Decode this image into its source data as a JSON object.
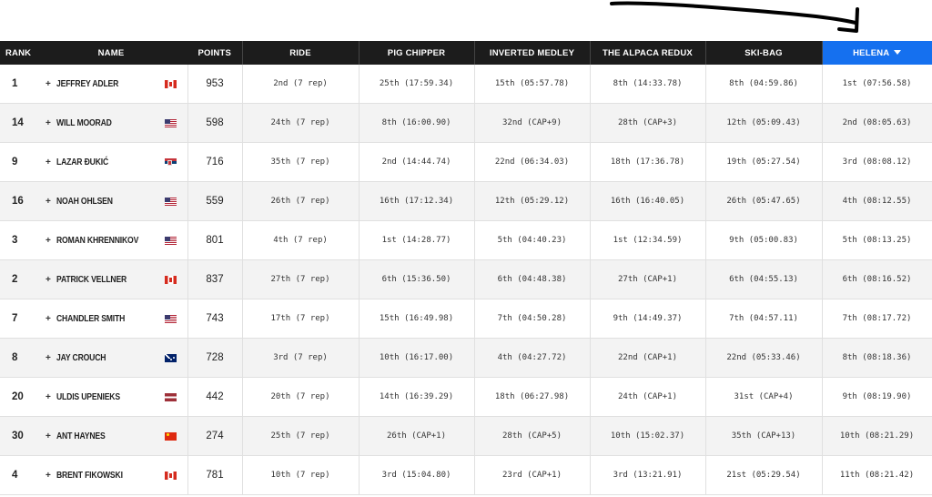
{
  "headers": {
    "rank": "RANK",
    "name": "NAME",
    "points": "POINTS",
    "events": [
      "RIDE",
      "PIG CHIPPER",
      "INVERTED MEDLEY",
      "THE ALPACA REDUX",
      "SKI-BAG",
      "HELENA"
    ],
    "sorted_event": "HELENA",
    "sort_icon": "caret-down-icon"
  },
  "colors": {
    "header_bg": "#1c1c1c",
    "active_header_bg": "#1570ef",
    "row_alt_bg": "#f3f3f3"
  },
  "rows": [
    {
      "rank": "1",
      "expand": "+",
      "name": "JEFFREY ADLER",
      "flag": "canada-flag-icon",
      "flag_class": "f-ca",
      "points": "953",
      "ride": "2nd (7 rep)",
      "pig_chipper": "25th (17:59.34)",
      "inverted_medley": "15th (05:57.78)",
      "alpaca_redux": "8th (14:33.78)",
      "ski_bag": "8th (04:59.86)",
      "helena": "1st (07:56.58)"
    },
    {
      "rank": "14",
      "expand": "+",
      "name": "WILL MOORAD",
      "flag": "usa-flag-icon",
      "flag_class": "f-us",
      "points": "598",
      "ride": "24th (7 rep)",
      "pig_chipper": "8th (16:00.90)",
      "inverted_medley": "32nd (CAP+9)",
      "alpaca_redux": "28th (CAP+3)",
      "ski_bag": "12th (05:09.43)",
      "helena": "2nd (08:05.63)"
    },
    {
      "rank": "9",
      "expand": "+",
      "name": "LAZAR ĐUKIĆ",
      "flag": "serbia-flag-icon",
      "flag_class": "f-rs",
      "points": "716",
      "ride": "35th (7 rep)",
      "pig_chipper": "2nd (14:44.74)",
      "inverted_medley": "22nd (06:34.03)",
      "alpaca_redux": "18th (17:36.78)",
      "ski_bag": "19th (05:27.54)",
      "helena": "3rd (08:08.12)"
    },
    {
      "rank": "16",
      "expand": "+",
      "name": "NOAH OHLSEN",
      "flag": "usa-flag-icon",
      "flag_class": "f-us",
      "points": "559",
      "ride": "26th (7 rep)",
      "pig_chipper": "16th (17:12.34)",
      "inverted_medley": "12th (05:29.12)",
      "alpaca_redux": "16th (16:40.05)",
      "ski_bag": "26th (05:47.65)",
      "helena": "4th (08:12.55)"
    },
    {
      "rank": "3",
      "expand": "+",
      "name": "ROMAN KHRENNIKOV",
      "flag": "usa-flag-icon",
      "flag_class": "f-us",
      "points": "801",
      "ride": "4th (7 rep)",
      "pig_chipper": "1st (14:28.77)",
      "inverted_medley": "5th (04:40.23)",
      "alpaca_redux": "1st (12:34.59)",
      "ski_bag": "9th (05:00.83)",
      "helena": "5th (08:13.25)"
    },
    {
      "rank": "2",
      "expand": "+",
      "name": "PATRICK VELLNER",
      "flag": "canada-flag-icon",
      "flag_class": "f-ca",
      "points": "837",
      "ride": "27th (7 rep)",
      "pig_chipper": "6th (15:36.50)",
      "inverted_medley": "6th (04:48.38)",
      "alpaca_redux": "27th (CAP+1)",
      "ski_bag": "6th (04:55.13)",
      "helena": "6th (08:16.52)"
    },
    {
      "rank": "7",
      "expand": "+",
      "name": "CHANDLER SMITH",
      "flag": "usa-flag-icon",
      "flag_class": "f-us",
      "points": "743",
      "ride": "17th (7 rep)",
      "pig_chipper": "15th (16:49.98)",
      "inverted_medley": "7th (04:50.28)",
      "alpaca_redux": "9th (14:49.37)",
      "ski_bag": "7th (04:57.11)",
      "helena": "7th (08:17.72)"
    },
    {
      "rank": "8",
      "expand": "+",
      "name": "JAY CROUCH",
      "flag": "australia-flag-icon",
      "flag_class": "f-au",
      "points": "728",
      "ride": "3rd (7 rep)",
      "pig_chipper": "10th (16:17.00)",
      "inverted_medley": "4th (04:27.72)",
      "alpaca_redux": "22nd (CAP+1)",
      "ski_bag": "22nd (05:33.46)",
      "helena": "8th (08:18.36)"
    },
    {
      "rank": "20",
      "expand": "+",
      "name": "ULDIS UPENIEKS",
      "flag": "latvia-flag-icon",
      "flag_class": "f-lv",
      "points": "442",
      "ride": "20th (7 rep)",
      "pig_chipper": "14th (16:39.29)",
      "inverted_medley": "18th (06:27.98)",
      "alpaca_redux": "24th (CAP+1)",
      "ski_bag": "31st (CAP+4)",
      "helena": "9th (08:19.90)"
    },
    {
      "rank": "30",
      "expand": "+",
      "name": "ANT HAYNES",
      "flag": "china-flag-icon",
      "flag_class": "f-cn",
      "points": "274",
      "ride": "25th (7 rep)",
      "pig_chipper": "26th (CAP+1)",
      "inverted_medley": "28th (CAP+5)",
      "alpaca_redux": "10th (15:02.37)",
      "ski_bag": "35th (CAP+13)",
      "helena": "10th (08:21.29)"
    },
    {
      "rank": "4",
      "expand": "+",
      "name": "BRENT FIKOWSKI",
      "flag": "canada-flag-icon",
      "flag_class": "f-ca",
      "points": "781",
      "ride": "10th (7 rep)",
      "pig_chipper": "3rd (15:04.80)",
      "inverted_medley": "23rd (CAP+1)",
      "alpaca_redux": "3rd (13:21.91)",
      "ski_bag": "21st (05:29.54)",
      "helena": "11th (08:21.42)"
    }
  ]
}
